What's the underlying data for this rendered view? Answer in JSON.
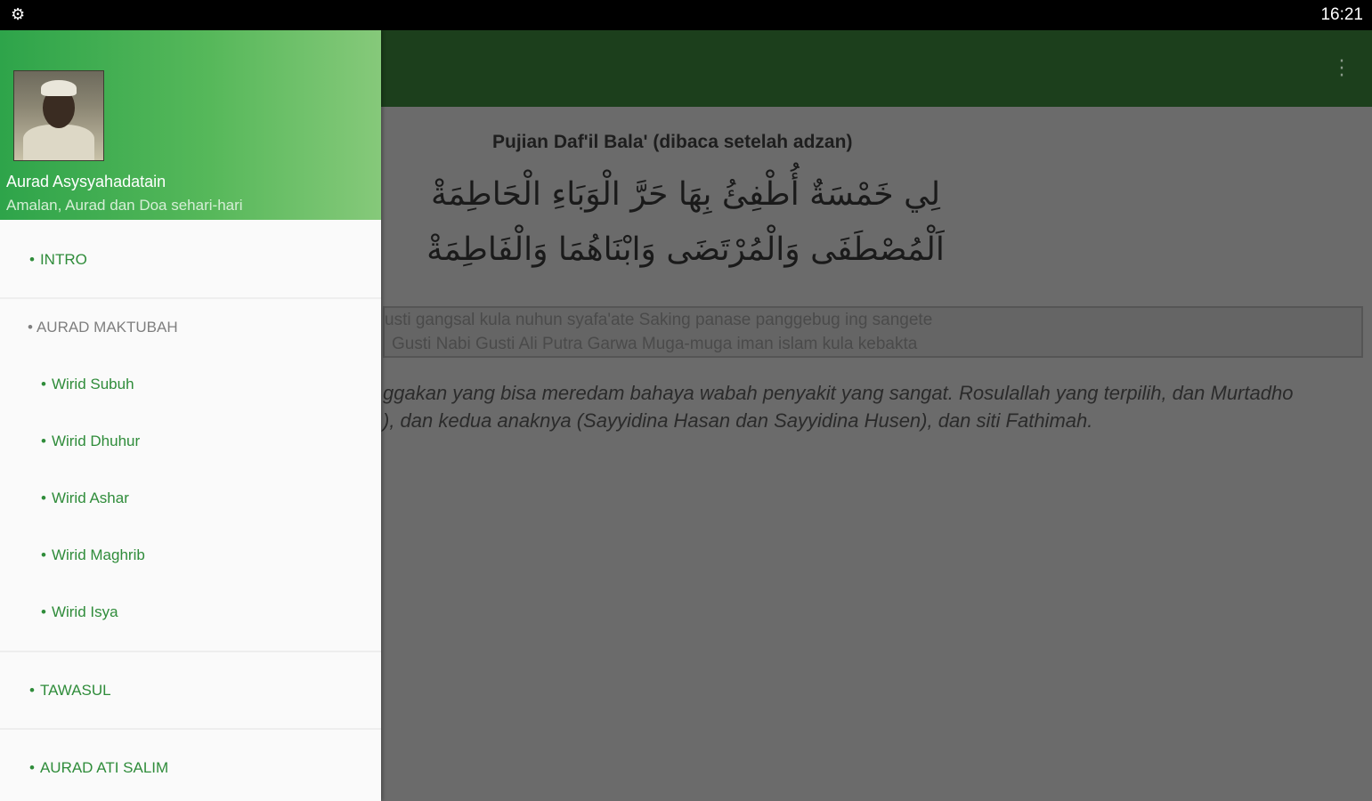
{
  "status_bar": {
    "app_icon": "settings-gear-icon",
    "time": "16:21"
  },
  "toolbar": {
    "menu_icon": "overflow-menu-icon"
  },
  "drawer": {
    "title": "Aurad Asysyahadatain",
    "subtitle": "Amalan, Aurad dan Doa sehari-hari",
    "avatar_icon": "profile-avatar",
    "items": [
      {
        "label": "INTRO",
        "type": "item"
      },
      {
        "label": "AURAD MAKTUBAH",
        "type": "section"
      },
      {
        "label": "Wirid Subuh",
        "type": "subitem"
      },
      {
        "label": "Wirid Dhuhur",
        "type": "subitem"
      },
      {
        "label": "Wirid Ashar",
        "type": "subitem"
      },
      {
        "label": "Wirid Maghrib",
        "type": "subitem"
      },
      {
        "label": "Wirid Isya",
        "type": "subitem"
      },
      {
        "label": "TAWASUL",
        "type": "item"
      },
      {
        "label": "AURAD ATI SALIM",
        "type": "item"
      }
    ]
  },
  "main": {
    "heading": "Pujian Daf'il Bala' (dibaca setelah adzan)",
    "arabic_line1": "لِي خَمْسَةٌ أُطْفِئُ بِهَا حَرَّ الْوَبَاءِ الْحَاطِمَةْ",
    "arabic_line2": "اَلْمُصْطَفَى وَالْمُرْتَضَى وَابْنَاهُمَا وَالْفَاطِمَةْ",
    "translit_line1": "usti gangsal kula nuhun syafa'ate Saking panase panggebug ing sangete",
    "translit_line2": "Gusti Nabi Gusti Ali Putra Garwa Muga-muga iman islam kula kebakta",
    "meaning_line1": "ggakan yang bisa meredam bahaya wabah penyakit yang sangat. Rosulallah yang terpilih, dan Murtadho",
    "meaning_line2": "), dan kedua anaknya (Sayyidina Hasan dan Sayyidina Husen), dan siti Fathimah."
  },
  "colors": {
    "toolbar": "#1c3f1c",
    "drawer_header_start": "#2ea44a",
    "drawer_header_end": "#86c97a",
    "nav_item": "#2f8c3a",
    "scrim": "#6b6b6b"
  }
}
